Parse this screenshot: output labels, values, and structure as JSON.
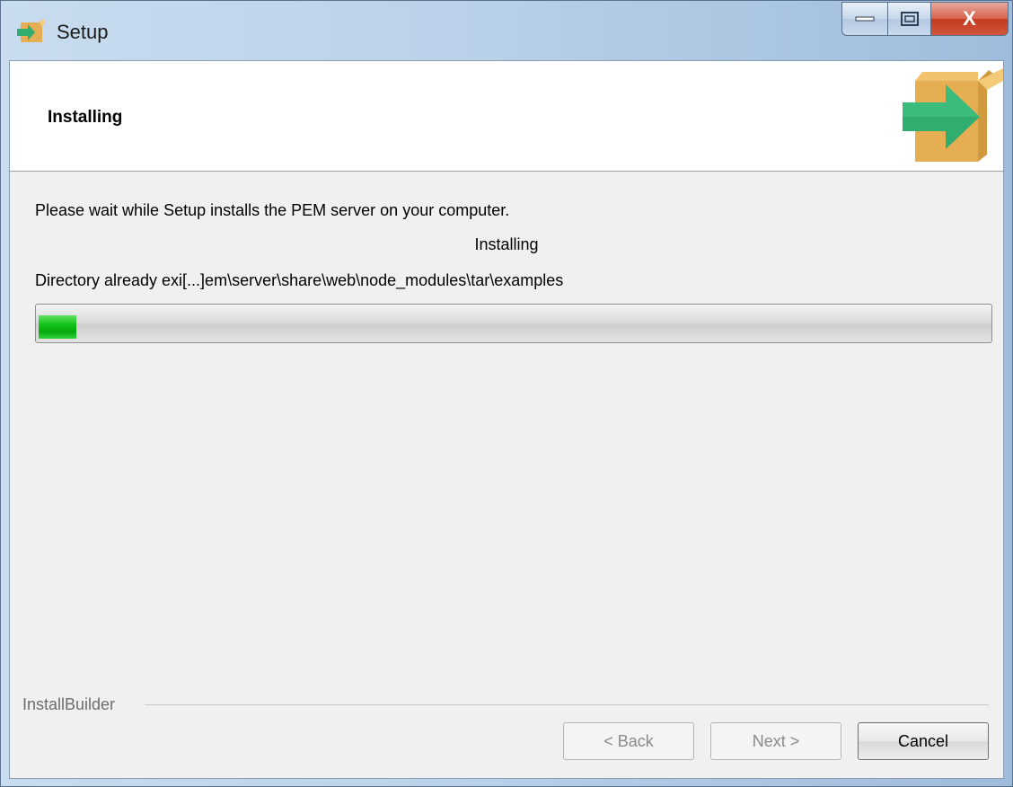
{
  "window": {
    "title": "Setup",
    "controls": {
      "minimize_icon": "minimize-icon",
      "maximize_icon": "maximize-icon",
      "close_label": "X"
    }
  },
  "header": {
    "title": "Installing",
    "icon": "installer-box-arrow-icon"
  },
  "body": {
    "description": "Please wait while Setup installs the PEM server on your computer.",
    "status": "Installing",
    "current_path": "Directory already exi[...]em\\server\\share\\web\\node_modules\\tar\\examples",
    "progress_fraction": 0.04
  },
  "footer": {
    "brand": "InstallBuilder",
    "back_label": "< Back",
    "next_label": "Next >",
    "cancel_label": "Cancel"
  },
  "colors": {
    "progress": "#12c31a",
    "accent": "#e6ae52",
    "arrow": "#2fae6f"
  }
}
